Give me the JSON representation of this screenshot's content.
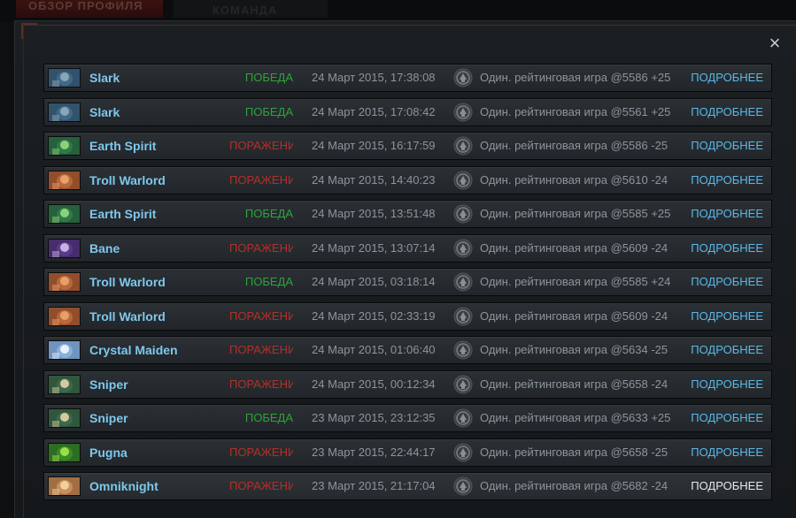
{
  "tabs": {
    "profile": "ОБЗОР ПРОФИЛЯ",
    "team": "КОМАНДА"
  },
  "close_label": "×",
  "matches": [
    {
      "hero": "Slark",
      "hero_key": "slark",
      "result": "ПОБЕДА",
      "outcome": "win",
      "datetime": "24 Март 2015, 17:38:08",
      "mode": "Один. рейтинговая игра @5586 +25",
      "details": "ПОДРОБНЕЕ"
    },
    {
      "hero": "Slark",
      "hero_key": "slark",
      "result": "ПОБЕДА",
      "outcome": "win",
      "datetime": "24 Март 2015, 17:08:42",
      "mode": "Один. рейтинговая игра @5561 +25",
      "details": "ПОДРОБНЕЕ"
    },
    {
      "hero": "Earth Spirit",
      "hero_key": "earth-spirit",
      "result": "ПОРАЖЕНИЕ",
      "outcome": "loss",
      "datetime": "24 Март 2015, 16:17:59",
      "mode": "Один. рейтинговая игра @5586 -25",
      "details": "ПОДРОБНЕЕ"
    },
    {
      "hero": "Troll Warlord",
      "hero_key": "troll-warlord",
      "result": "ПОРАЖЕНИЕ",
      "outcome": "loss",
      "datetime": "24 Март 2015, 14:40:23",
      "mode": "Один. рейтинговая игра @5610 -24",
      "details": "ПОДРОБНЕЕ"
    },
    {
      "hero": "Earth Spirit",
      "hero_key": "earth-spirit",
      "result": "ПОБЕДА",
      "outcome": "win",
      "datetime": "24 Март 2015, 13:51:48",
      "mode": "Один. рейтинговая игра @5585 +25",
      "details": "ПОДРОБНЕЕ"
    },
    {
      "hero": "Bane",
      "hero_key": "bane",
      "result": "ПОРАЖЕНИЕ",
      "outcome": "loss",
      "datetime": "24 Март 2015, 13:07:14",
      "mode": "Один. рейтинговая игра @5609 -24",
      "details": "ПОДРОБНЕЕ"
    },
    {
      "hero": "Troll Warlord",
      "hero_key": "troll-warlord",
      "result": "ПОБЕДА",
      "outcome": "win",
      "datetime": "24 Март 2015, 03:18:14",
      "mode": "Один. рейтинговая игра @5585 +24",
      "details": "ПОДРОБНЕЕ"
    },
    {
      "hero": "Troll Warlord",
      "hero_key": "troll-warlord",
      "result": "ПОРАЖЕНИЕ",
      "outcome": "loss",
      "datetime": "24 Март 2015, 02:33:19",
      "mode": "Один. рейтинговая игра @5609 -24",
      "details": "ПОДРОБНЕЕ"
    },
    {
      "hero": "Crystal Maiden",
      "hero_key": "crystal-maiden",
      "result": "ПОРАЖЕНИЕ",
      "outcome": "loss",
      "datetime": "24 Март 2015, 01:06:40",
      "mode": "Один. рейтинговая игра @5634 -25",
      "details": "ПОДРОБНЕЕ"
    },
    {
      "hero": "Sniper",
      "hero_key": "sniper",
      "result": "ПОРАЖЕНИЕ",
      "outcome": "loss",
      "datetime": "24 Март 2015, 00:12:34",
      "mode": "Один. рейтинговая игра @5658 -24",
      "details": "ПОДРОБНЕЕ"
    },
    {
      "hero": "Sniper",
      "hero_key": "sniper",
      "result": "ПОБЕДА",
      "outcome": "win",
      "datetime": "23 Март 2015, 23:12:35",
      "mode": "Один. рейтинговая игра @5633 +25",
      "details": "ПОДРОБНЕЕ"
    },
    {
      "hero": "Pugna",
      "hero_key": "pugna",
      "result": "ПОРАЖЕНИЕ",
      "outcome": "loss",
      "datetime": "23 Март 2015, 22:44:17",
      "mode": "Один. рейтинговая игра @5658 -25",
      "details": "ПОДРОБНЕЕ"
    },
    {
      "hero": "Omniknight",
      "hero_key": "omniknight",
      "result": "ПОРАЖЕНИЕ",
      "outcome": "loss",
      "datetime": "23 Март 2015, 21:17:04",
      "mode": "Один. рейтинговая игра @5682 -24",
      "details": "ПОДРОБНЕЕ",
      "active": true
    }
  ],
  "hero_colors": {
    "slark": [
      "#3f6a8a",
      "#8aa7b6",
      "#1f2f3c"
    ],
    "earth-spirit": [
      "#2f7a4a",
      "#8ecf7a",
      "#1b3a28"
    ],
    "troll-warlord": [
      "#b8683a",
      "#e7a06a",
      "#5a2a18"
    ],
    "bane": [
      "#5a3a8a",
      "#c8b0e0",
      "#2a1a40"
    ],
    "crystal-maiden": [
      "#8ab0d8",
      "#e8f0ff",
      "#4a6a9a"
    ],
    "sniper": [
      "#3a6a4a",
      "#d8c8a0",
      "#223a2a"
    ],
    "pugna": [
      "#3a8a2a",
      "#9ae04a",
      "#1a4018"
    ],
    "omniknight": [
      "#c89058",
      "#f0d0a0",
      "#6a4028"
    ]
  },
  "colors": {
    "win": "#2fa33b",
    "loss": "#b3302a",
    "hero_name": "#7ec8ee",
    "details_link": "#5ab8ea"
  }
}
